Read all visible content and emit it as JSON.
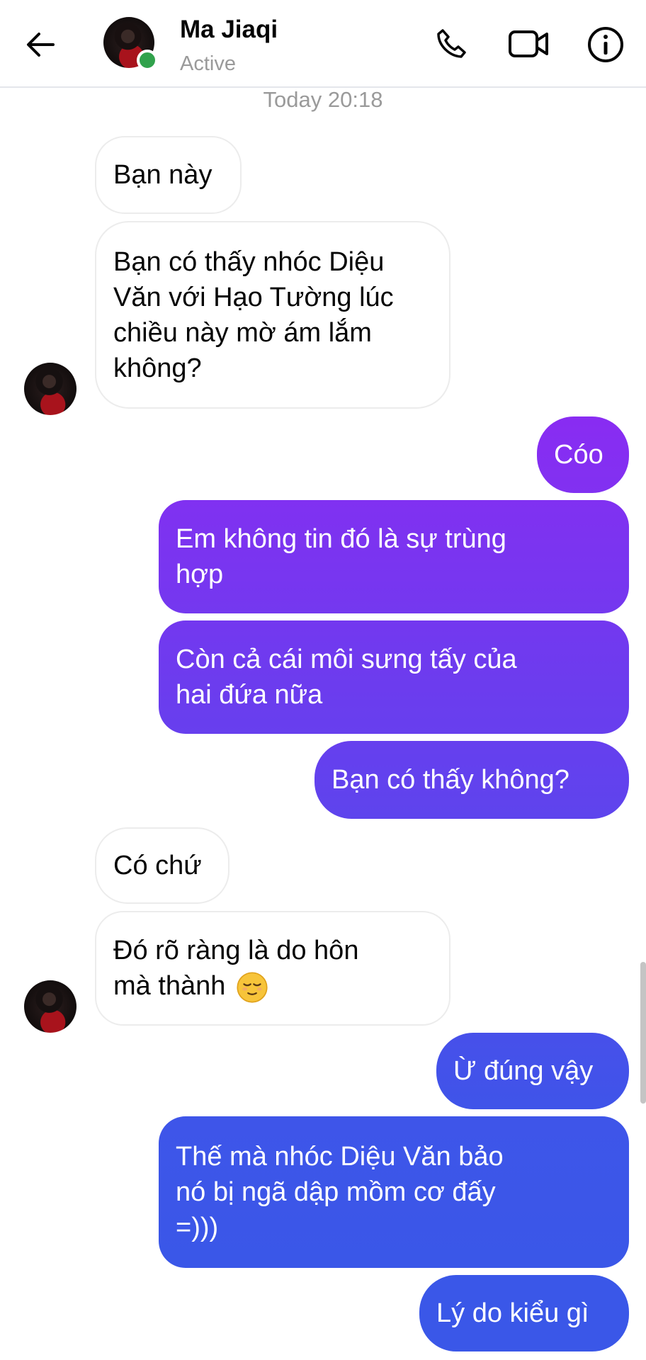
{
  "header": {
    "contact_name": "Ma Jiaqi",
    "contact_status": "Active",
    "back_icon": "arrow-left-icon",
    "call_icon": "phone-icon",
    "video_icon": "video-camera-icon",
    "info_icon": "info-icon"
  },
  "timestamp": "Today 20:18",
  "colors": {
    "incoming_bg": "#ffffff",
    "outgoing_top": "#8a2cf2",
    "outgoing_bottom": "#3a57e8",
    "online": "#31a24c"
  },
  "messages": [
    {
      "from": "them",
      "lines": [
        "Bạn này"
      ]
    },
    {
      "from": "them",
      "lines": [
        "Bạn có thấy nhóc Diệu",
        "Văn với Hạo Tường lúc",
        "chiều này mờ ám lắm",
        "không?"
      ]
    },
    {
      "from": "me",
      "lines": [
        "Cóo"
      ]
    },
    {
      "from": "me",
      "lines": [
        "Em không tin đó là sự trùng",
        "hợp"
      ]
    },
    {
      "from": "me",
      "lines": [
        "Còn cả cái môi sưng tấy của",
        "hai đứa nữa"
      ]
    },
    {
      "from": "me",
      "lines": [
        "Bạn có thấy không?"
      ]
    },
    {
      "from": "them",
      "lines": [
        "Có chứ"
      ]
    },
    {
      "from": "them",
      "lines": [
        "Đó rõ ràng là do hôn",
        "mà thành"
      ],
      "emoji": "relieved-face-emoji"
    },
    {
      "from": "me",
      "lines": [
        "Ừ đúng vậy"
      ]
    },
    {
      "from": "me",
      "lines": [
        "Thế mà nhóc Diệu Văn bảo",
        "nó bị ngã dập mồm cơ đấy",
        "=)))"
      ]
    },
    {
      "from": "me",
      "lines": [
        "Lý do kiểu gì"
      ]
    }
  ]
}
